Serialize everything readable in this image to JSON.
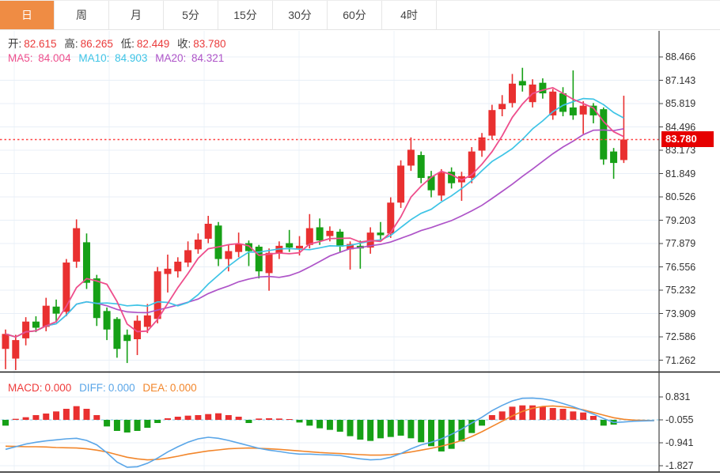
{
  "toolbar": {
    "tabs": [
      {
        "label": "日",
        "active": true
      },
      {
        "label": "周",
        "active": false
      },
      {
        "label": "月",
        "active": false
      },
      {
        "label": "5分",
        "active": false
      },
      {
        "label": "15分",
        "active": false
      },
      {
        "label": "30分",
        "active": false
      },
      {
        "label": "60分",
        "active": false
      },
      {
        "label": "4时",
        "active": false
      }
    ]
  },
  "info_bar": {
    "open_label": "开:",
    "open": "82.615",
    "high_label": "高:",
    "high": "86.265",
    "low_label": "低:",
    "low": "82.449",
    "close_label": "收:",
    "close": "83.780"
  },
  "ma_bar": {
    "ma5_label": "MA5:",
    "ma5": "84.004",
    "ma10_label": "MA10:",
    "ma10": "84.903",
    "ma20_label": "MA20:",
    "ma20": "84.321"
  },
  "macd_bar": {
    "macd_label": "MACD:",
    "macd": "0.000",
    "diff_label": "DIFF:",
    "diff": "0.000",
    "dea_label": "DEA:",
    "dea": "0.000"
  },
  "colors": {
    "accent_orange": "#ef8c44",
    "up_red": "#e93030",
    "down_green": "#16a016",
    "ma5_pink": "#ee4e8c",
    "ma10_cyan": "#3ec4e6",
    "ma20_purple": "#ae54c8",
    "diff_blue": "#5aa6e8",
    "dea_orange": "#f2862b",
    "macd_label_red": "#ef3b3b",
    "tag_red": "#e60000",
    "grid": "#e8eff7",
    "axis": "#444444",
    "zero_dash": "#a8dcef",
    "dotted_line_red": "#ff4343"
  },
  "chart_data": {
    "type": "candlestick+macd",
    "title": "",
    "legend": [
      "MA5",
      "MA10",
      "MA20",
      "MACD",
      "DIFF",
      "DEA"
    ],
    "grid": true,
    "price_axis": {
      "labels": [
        "88.466",
        "87.143",
        "85.819",
        "84.496",
        "83.173",
        "81.849",
        "80.526",
        "79.203",
        "77.879",
        "76.556",
        "75.232",
        "73.909",
        "72.586",
        "71.262"
      ],
      "max": 88.466,
      "min": 71.262
    },
    "macd_axis": {
      "labels": [
        "0.831",
        "-0.055",
        "-0.941",
        "-1.827"
      ]
    },
    "last_price_tag": "83.780",
    "last_price": 83.78,
    "candles_format": [
      "open",
      "high",
      "low",
      "close"
    ],
    "candles": [
      [
        71.9,
        73.0,
        70.75,
        72.75
      ],
      [
        71.35,
        72.7,
        70.7,
        72.4
      ],
      [
        72.5,
        73.7,
        72.1,
        73.45
      ],
      [
        73.45,
        73.75,
        72.85,
        73.1
      ],
      [
        73.15,
        74.8,
        72.9,
        74.35
      ],
      [
        74.3,
        74.7,
        73.4,
        73.9
      ],
      [
        74.0,
        77.0,
        73.75,
        76.8
      ],
      [
        76.85,
        79.25,
        76.5,
        78.75
      ],
      [
        77.95,
        78.45,
        75.3,
        75.65
      ],
      [
        75.9,
        76.1,
        73.2,
        73.65
      ],
      [
        74.05,
        74.25,
        72.4,
        73.0
      ],
      [
        73.6,
        73.7,
        71.4,
        71.9
      ],
      [
        72.7,
        73.0,
        71.1,
        72.35
      ],
      [
        72.45,
        73.8,
        71.55,
        73.5
      ],
      [
        73.15,
        74.45,
        72.8,
        73.8
      ],
      [
        73.6,
        76.55,
        73.35,
        76.3
      ],
      [
        76.15,
        77.25,
        75.1,
        76.45
      ],
      [
        76.3,
        77.1,
        75.95,
        76.85
      ],
      [
        76.8,
        78.0,
        76.55,
        77.5
      ],
      [
        77.55,
        78.45,
        77.3,
        78.1
      ],
      [
        78.15,
        79.45,
        77.9,
        79.0
      ],
      [
        78.9,
        79.1,
        76.6,
        77.0
      ],
      [
        77.0,
        77.8,
        76.3,
        77.45
      ],
      [
        77.4,
        78.5,
        77.1,
        77.85
      ],
      [
        77.9,
        78.05,
        76.6,
        77.45
      ],
      [
        77.7,
        77.8,
        75.9,
        76.3
      ],
      [
        76.2,
        77.6,
        75.2,
        77.35
      ],
      [
        77.3,
        78.0,
        77.0,
        77.75
      ],
      [
        77.9,
        78.65,
        77.4,
        77.65
      ],
      [
        77.6,
        78.3,
        77.2,
        77.75
      ],
      [
        77.8,
        79.55,
        77.6,
        78.75
      ],
      [
        78.8,
        79.3,
        77.8,
        78.05
      ],
      [
        78.3,
        78.85,
        78.0,
        78.6
      ],
      [
        78.55,
        78.7,
        77.35,
        77.7
      ],
      [
        77.55,
        78.0,
        76.4,
        77.85
      ],
      [
        77.75,
        78.05,
        76.45,
        77.6
      ],
      [
        77.65,
        78.8,
        77.3,
        78.5
      ],
      [
        78.5,
        79.1,
        78.0,
        78.35
      ],
      [
        78.45,
        80.5,
        78.2,
        80.2
      ],
      [
        80.2,
        82.6,
        79.9,
        82.3
      ],
      [
        82.3,
        83.9,
        82.0,
        83.2
      ],
      [
        82.9,
        83.1,
        81.3,
        81.6
      ],
      [
        81.7,
        82.0,
        80.5,
        80.9
      ],
      [
        80.6,
        82.1,
        80.3,
        81.9
      ],
      [
        81.95,
        82.2,
        81.0,
        81.3
      ],
      [
        81.35,
        81.95,
        80.3,
        81.7
      ],
      [
        81.6,
        83.35,
        81.3,
        83.1
      ],
      [
        83.15,
        84.15,
        82.8,
        83.9
      ],
      [
        84.0,
        85.75,
        83.8,
        85.45
      ],
      [
        85.5,
        86.3,
        85.1,
        85.8
      ],
      [
        85.85,
        87.5,
        85.6,
        86.95
      ],
      [
        87.1,
        87.85,
        86.5,
        86.85
      ],
      [
        85.9,
        87.2,
        85.6,
        86.9
      ],
      [
        87.0,
        87.25,
        86.1,
        86.4
      ],
      [
        85.15,
        86.65,
        84.9,
        86.5
      ],
      [
        86.4,
        86.75,
        85.1,
        85.35
      ],
      [
        85.6,
        87.7,
        84.9,
        85.15
      ],
      [
        85.2,
        85.95,
        84.1,
        85.7
      ],
      [
        85.7,
        85.85,
        84.7,
        85.15
      ],
      [
        85.5,
        85.6,
        82.35,
        82.65
      ],
      [
        83.1,
        83.3,
        81.55,
        82.45
      ],
      [
        82.615,
        86.265,
        82.449,
        83.78
      ]
    ],
    "ma_periods": [
      5,
      10,
      20
    ],
    "macd_hist": [
      -0.22,
      0.04,
      0.1,
      0.18,
      0.24,
      0.32,
      0.42,
      0.52,
      0.42,
      0.18,
      -0.25,
      -0.42,
      -0.48,
      -0.42,
      -0.3,
      -0.12,
      0.06,
      0.12,
      0.16,
      0.18,
      0.22,
      0.25,
      0.18,
      0.12,
      -0.12,
      0.05,
      0.06,
      0.05,
      0.03,
      -0.1,
      -0.22,
      -0.32,
      -0.38,
      -0.45,
      -0.62,
      -0.75,
      -0.8,
      -0.7,
      -0.65,
      -0.6,
      -0.7,
      -0.85,
      -1.0,
      -1.2,
      -1.1,
      -0.82,
      -0.5,
      -0.22,
      0.18,
      0.32,
      0.5,
      0.55,
      0.55,
      0.5,
      0.45,
      0.42,
      0.32,
      0.28,
      0.15,
      -0.22,
      -0.18,
      0.0
    ],
    "diff_line": [
      -1.12,
      -1.02,
      -0.92,
      -0.85,
      -0.8,
      -0.76,
      -0.72,
      -0.7,
      -0.78,
      -0.95,
      -1.25,
      -1.6,
      -1.8,
      -1.78,
      -1.65,
      -1.45,
      -1.22,
      -1.02,
      -0.85,
      -0.72,
      -0.66,
      -0.7,
      -0.78,
      -0.88,
      -0.98,
      -1.08,
      -1.15,
      -1.2,
      -1.26,
      -1.3,
      -1.3,
      -1.32,
      -1.33,
      -1.35,
      -1.42,
      -1.48,
      -1.52,
      -1.5,
      -1.42,
      -1.28,
      -1.1,
      -0.95,
      -0.85,
      -0.72,
      -0.55,
      -0.35,
      -0.12,
      0.1,
      0.35,
      0.55,
      0.72,
      0.82,
      0.83,
      0.8,
      0.73,
      0.62,
      0.5,
      0.36,
      0.22,
      0.05,
      -0.1,
      -0.08,
      -0.05,
      -0.04,
      -0.03
    ],
    "dea_line": [
      -1.0,
      -1.01,
      -1.02,
      -1.02,
      -1.03,
      -1.05,
      -1.06,
      -1.07,
      -1.1,
      -1.15,
      -1.22,
      -1.32,
      -1.42,
      -1.48,
      -1.52,
      -1.5,
      -1.45,
      -1.38,
      -1.3,
      -1.24,
      -1.18,
      -1.14,
      -1.1,
      -1.08,
      -1.07,
      -1.08,
      -1.1,
      -1.12,
      -1.15,
      -1.18,
      -1.21,
      -1.24,
      -1.26,
      -1.28,
      -1.3,
      -1.32,
      -1.34,
      -1.34,
      -1.32,
      -1.28,
      -1.22,
      -1.15,
      -1.08,
      -1.0,
      -0.9,
      -0.78,
      -0.63,
      -0.45,
      -0.25,
      -0.05,
      0.15,
      0.32,
      0.44,
      0.51,
      0.53,
      0.5,
      0.45,
      0.38,
      0.28,
      0.18,
      0.08,
      0.02,
      -0.01,
      -0.02,
      -0.03
    ]
  }
}
